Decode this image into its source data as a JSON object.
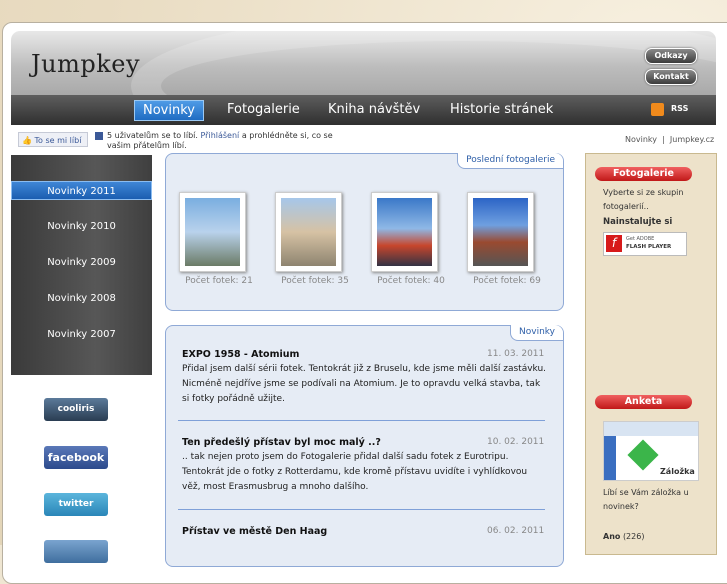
{
  "header": {
    "logo": "Jumpkey",
    "buttons": [
      "Odkazy",
      "Kontakt"
    ],
    "nav": [
      "Novinky",
      "Fotogalerie",
      "Kniha návštěv",
      "Historie stránek"
    ],
    "rss": "RSS"
  },
  "social": {
    "like_button": "To se mi líbí",
    "like_text_1": "5 uživatelům se to líbí.",
    "like_link": "Přihlášení",
    "like_text_2": "a prohlédněte si, co se vašim přátelům líbí."
  },
  "breadcrumb": {
    "items": [
      "Novinky",
      "Jumpkey.cz"
    ],
    "separator": "|"
  },
  "sidebar": {
    "items": [
      "Novinky 2011",
      "Novinky 2010",
      "Novinky 2009",
      "Novinky 2008",
      "Novinky 2007"
    ],
    "badges": [
      "cooliris",
      "facebook",
      "twitter"
    ]
  },
  "galleries": {
    "tab": "Poslední fotogalerie",
    "items": [
      {
        "caption": "Počet fotek: 21"
      },
      {
        "caption": "Počet fotek: 35"
      },
      {
        "caption": "Počet fotek: 40"
      },
      {
        "caption": "Počet fotek: 69"
      }
    ]
  },
  "news": {
    "tab": "Novinky",
    "items": [
      {
        "title": "EXPO 1958 - Atomium",
        "date": "11. 03. 2011",
        "body": "Přidal jsem další sérii fotek. Tentokrát již z Bruselu, kde jsme měli další zastávku. Nicméně nejdříve jsme se podívali na Atomium. Je to opravdu velká stavba, tak si fotky pořádně užijte."
      },
      {
        "title": "Ten předešlý přístav byl moc malý ..?",
        "date": "10. 02. 2011",
        "body": ".. tak nejen proto jsem do Fotogalerie přidal další sadu fotek z Eurotripu. Tentokrát jde o fotky z Rotterdamu, kde kromě přístavu uvidíte i vyhlídkovou věž, most Erasmusbrug a mnoho dalšího."
      },
      {
        "title": "Přístav ve městě Den Haag",
        "date": "06. 02. 2011",
        "body": ""
      }
    ]
  },
  "right": {
    "photo_head": "Fotogalerie",
    "photo_text": "Vyberte si ze skupin fotogalerií..",
    "install": "Nainstalujte si",
    "flash_small": "Get ADOBE",
    "flash_big": "FLASH PLAYER",
    "poll_head": "Anketa",
    "poll_img_label": "Záložka",
    "poll_question": "Líbí se Vám záložka u novinek?",
    "poll_answer": "Ano",
    "poll_count": "(226)"
  },
  "colors": {
    "accent_blue": "#1f6cc2",
    "panel_border": "#8fa9d6",
    "red_head": "#c01818"
  }
}
